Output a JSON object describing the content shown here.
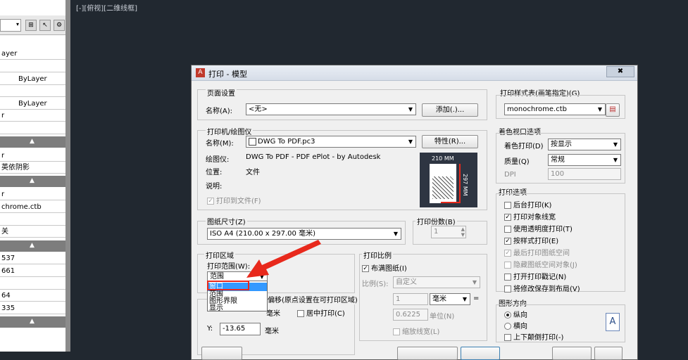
{
  "palette": {
    "rows": [
      "ayer",
      "",
      "ByLayer",
      "",
      "ByLayer",
      "",
      "r",
      "",
      "r",
      "英依阴影",
      "r",
      "chrome.ctb",
      "",
      "关",
      "537",
      "661",
      "",
      "64",
      "335"
    ]
  },
  "canvas": {
    "viewport_label": "[-][俯视][二维线框]"
  },
  "dialog": {
    "title": "打印 - 模型",
    "close_label": "✖",
    "page_setup": {
      "group_label": "页面设置",
      "name_label": "名称(A):",
      "name_value": "<无>",
      "add_button": "添加(.)..."
    },
    "printer": {
      "group_label": "打印机/绘图仪",
      "name_label": "名称(M):",
      "name_value": "DWG To PDF.pc3",
      "properties_button": "特性(R)...",
      "plotter_label": "绘图仪:",
      "plotter_value": "DWG To PDF - PDF ePlot - by Autodesk",
      "where_label": "位置:",
      "where_value": "文件",
      "desc_label": "说明:",
      "plot_to_file": "打印到文件(F)",
      "preview_width": "210 MM",
      "preview_height": "297 MM"
    },
    "paper_size": {
      "group_label": "图纸尺寸(Z)",
      "value": "ISO A4 (210.00 x 297.00 毫米)"
    },
    "copies": {
      "label": "打印份数(B)",
      "value": "1"
    },
    "plot_area": {
      "group_label": "打印区域",
      "what_label": "打印范围(W):",
      "what_value": "范围",
      "options": [
        "窗口",
        "范围",
        "图形界限",
        "显示"
      ]
    },
    "plot_offset": {
      "group_label": "打印偏移(原点设置在可打印区域)",
      "x_unit": "毫米",
      "center_plot": "居中打印(C)",
      "y_label": "Y:",
      "y_value": "-13.65",
      "y_unit": "毫米"
    },
    "plot_scale": {
      "group_label": "打印比例",
      "fit_to_paper": "布满图纸(I)",
      "scale_label": "比例(S):",
      "scale_value": "自定义",
      "value1": "1",
      "unit1": "毫米",
      "value2": "0.6225",
      "unit2": "单位(N)",
      "scale_lineweights": "缩放线宽(L)"
    },
    "plot_style_table": {
      "group_label": "打印样式表(画笔指定)(G)",
      "value": "monochrome.ctb"
    },
    "shaded_viewport": {
      "group_label": "着色视口选项",
      "shade_label": "着色打印(D)",
      "shade_value": "按显示",
      "quality_label": "质量(Q)",
      "quality_value": "常规",
      "dpi_label": "DPI",
      "dpi_value": "100"
    },
    "plot_options": {
      "group_label": "打印选项",
      "items": [
        {
          "label": "后台打印(K)",
          "checked": false,
          "enabled": true
        },
        {
          "label": "打印对象线宽",
          "checked": true,
          "enabled": true
        },
        {
          "label": "使用透明度打印(T)",
          "checked": false,
          "enabled": true
        },
        {
          "label": "按样式打印(E)",
          "checked": true,
          "enabled": true
        },
        {
          "label": "最后打印图纸空间",
          "checked": true,
          "enabled": false
        },
        {
          "label": "隐藏图纸空间对象(J)",
          "checked": false,
          "enabled": false
        },
        {
          "label": "打开打印戳记(N)",
          "checked": false,
          "enabled": true
        },
        {
          "label": "将修改保存到布局(V)",
          "checked": false,
          "enabled": true
        }
      ]
    },
    "orientation": {
      "group_label": "图形方向",
      "portrait": "纵向",
      "landscape": "横向",
      "upside_down": "上下颠倒打印(-)",
      "icon_letter": "A"
    }
  },
  "colors": {
    "canvas_bg": "#212830",
    "selection": "#3399ff",
    "annotation_red": "#e8291c"
  }
}
